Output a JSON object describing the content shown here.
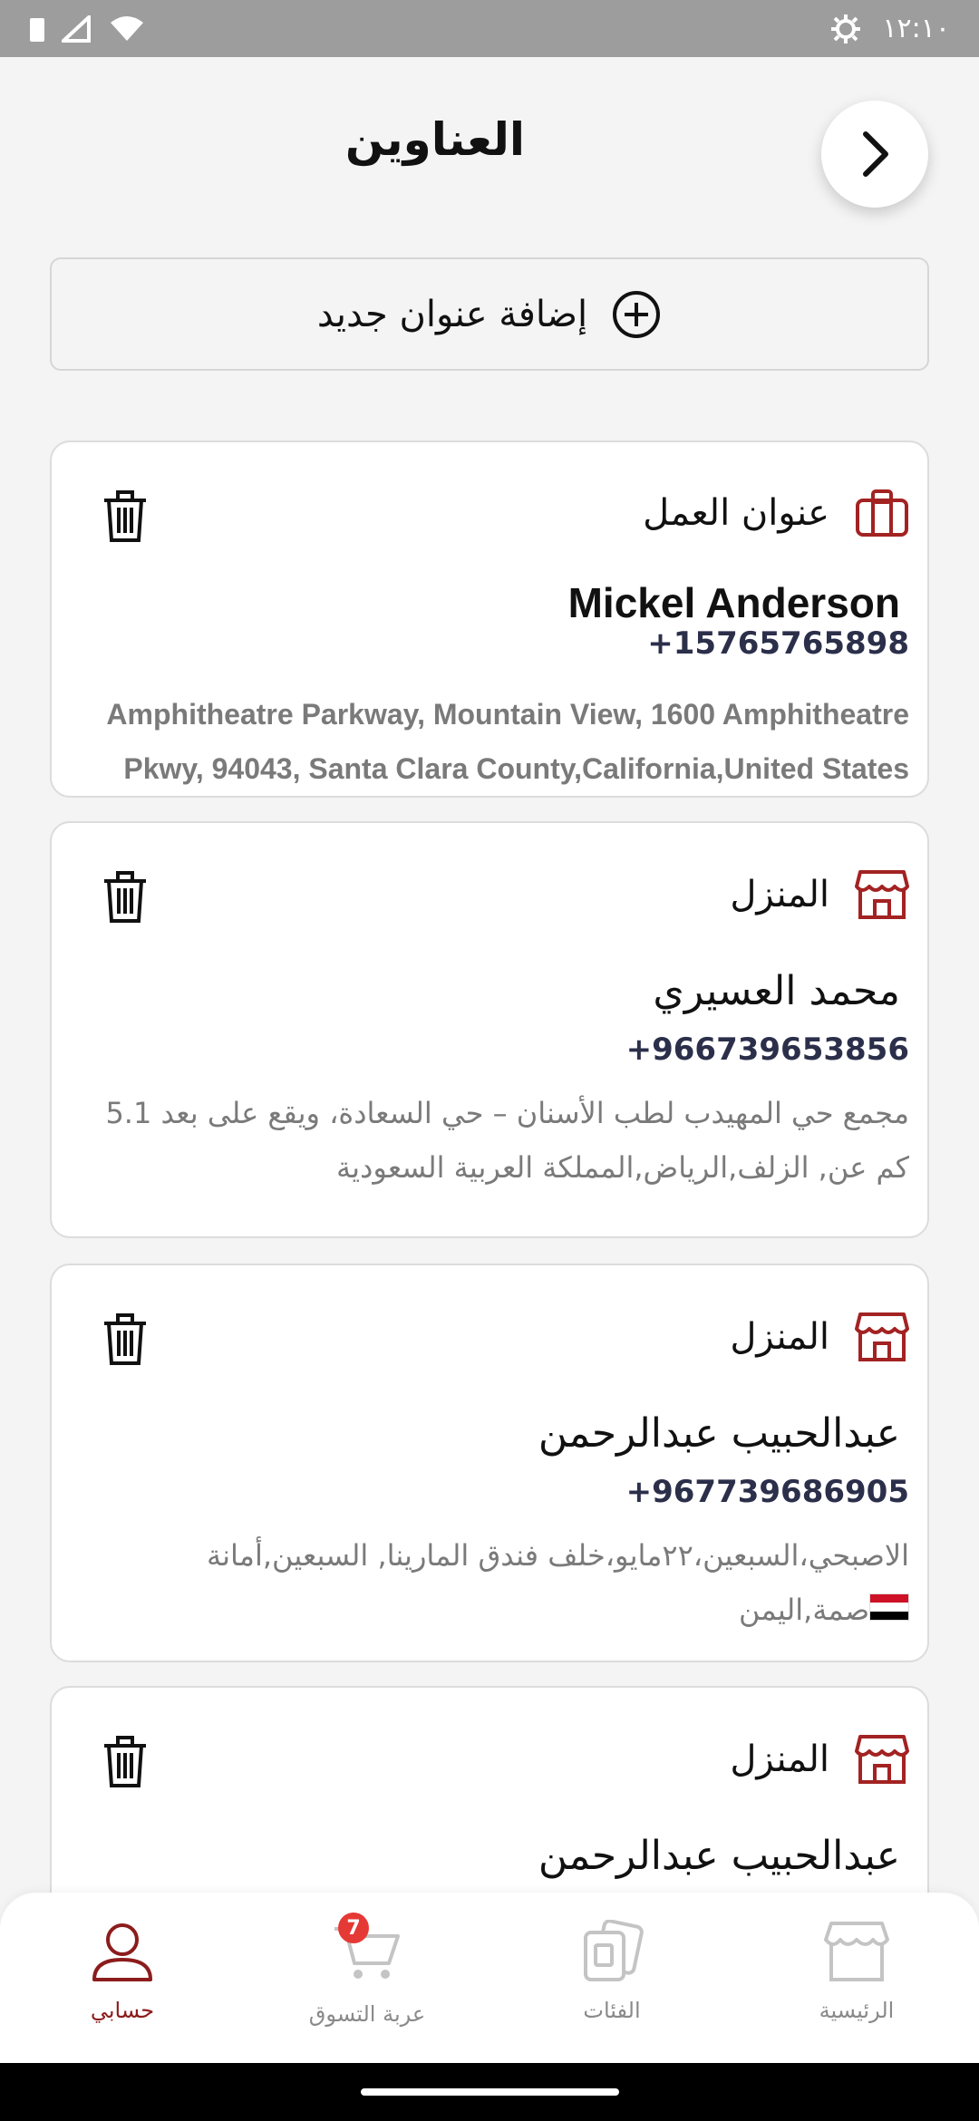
{
  "status_bar": {
    "time": "١٢:١٠",
    "icons": [
      "sim-icon",
      "signal-icon",
      "wifi-icon",
      "settings-gear-icon"
    ]
  },
  "header": {
    "title": "العناوين",
    "back_icon": "chevron-right-icon"
  },
  "add_address": {
    "label": "إضافة عنوان جديد",
    "icon": "plus-circle-icon"
  },
  "addresses": [
    {
      "type_label": "عنوان العمل",
      "type_icon": "briefcase-icon",
      "name": "Mickel Anderson",
      "phone": "+15765765898",
      "address": "Amphitheatre Parkway, Mountain View, 1600 Amphitheatre Pkwy, 94043, Santa Clara County,California,United States"
    },
    {
      "type_label": "المنزل",
      "type_icon": "store-icon",
      "name": "محمد العسيري",
      "phone": "+966739653856",
      "address": "مجمع حي المهيدب لطب الأسنان – حي السعادة، ويقع على بعد 5.1 كم عن, الزلف,الرياض,المملكة العربية السعودية"
    },
    {
      "type_label": "المنزل",
      "type_icon": "store-icon",
      "name": "عبدالحبيب عبدالرحمن",
      "phone": "+967739686905",
      "address": "الاصبحي،السبعين،٢٢مايو،خلف فندق المارينا, السبعين,أمانة العاصمة,اليمن",
      "flag": "yemen-flag"
    },
    {
      "type_label": "المنزل",
      "type_icon": "store-icon",
      "name": "عبدالحبيب عبدالرحمن"
    }
  ],
  "bottom_nav": [
    {
      "label": "حسابي",
      "icon": "user-icon",
      "active": true
    },
    {
      "label": "عربة التسوق",
      "icon": "cart-icon",
      "badge": "7"
    },
    {
      "label": "الفئات",
      "icon": "categories-icon"
    },
    {
      "label": "الرئيسية",
      "icon": "home-store-icon"
    }
  ],
  "colors": {
    "accent": "#8c1c1c",
    "icon_red": "#a32222",
    "phone": "#2b2f4a",
    "badge": "#e53935"
  }
}
